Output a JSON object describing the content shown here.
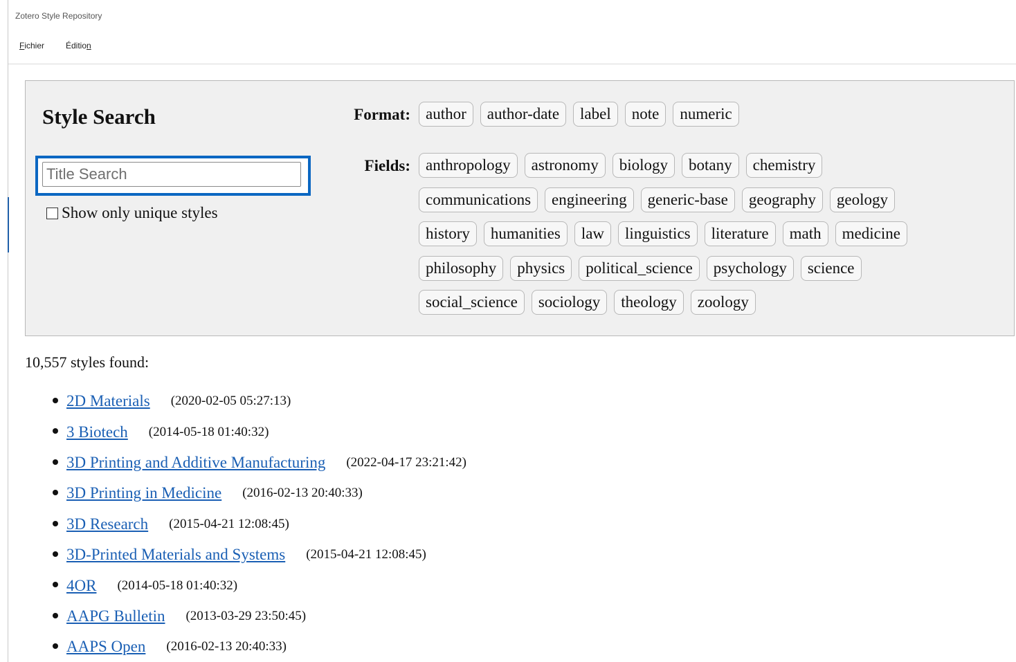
{
  "window": {
    "title": "Zotero Style Repository"
  },
  "menu": {
    "fichier": "Fichier",
    "edition": "Édition"
  },
  "search": {
    "heading": "Style Search",
    "placeholder": "Title Search",
    "unique_label": "Show only unique styles",
    "unique_checked": false
  },
  "filters": {
    "format_label": "Format:",
    "formats": [
      "author",
      "author-date",
      "label",
      "note",
      "numeric"
    ],
    "fields_label": "Fields:",
    "fields_rows": [
      [
        "anthropology",
        "astronomy",
        "biology",
        "botany",
        "chemistry"
      ],
      [
        "communications",
        "engineering",
        "generic-base",
        "geography",
        "geology"
      ],
      [
        "history",
        "humanities",
        "law",
        "linguistics",
        "literature",
        "math",
        "medicine"
      ],
      [
        "philosophy",
        "physics",
        "political_science",
        "psychology",
        "science"
      ],
      [
        "social_science",
        "sociology",
        "theology",
        "zoology"
      ]
    ]
  },
  "results": {
    "count_text": "10,557 styles found:",
    "items": [
      {
        "title": "2D Materials",
        "date": "(2020-02-05 05:27:13)"
      },
      {
        "title": "3 Biotech",
        "date": "(2014-05-18 01:40:32)"
      },
      {
        "title": "3D Printing and Additive Manufacturing",
        "date": "(2022-04-17 23:21:42)"
      },
      {
        "title": "3D Printing in Medicine",
        "date": "(2016-02-13 20:40:33)"
      },
      {
        "title": "3D Research",
        "date": "(2015-04-21 12:08:45)"
      },
      {
        "title": "3D-Printed Materials and Systems",
        "date": "(2015-04-21 12:08:45)"
      },
      {
        "title": "4OR",
        "date": "(2014-05-18 01:40:32)"
      },
      {
        "title": "AAPG Bulletin",
        "date": "(2013-03-29 23:50:45)"
      },
      {
        "title": "AAPS Open",
        "date": "(2016-02-13 20:40:33)"
      }
    ]
  },
  "colors": {
    "accent_focus": "#0b67c2",
    "link": "#1a5fb4",
    "panel_bg": "#f0f0f0"
  }
}
